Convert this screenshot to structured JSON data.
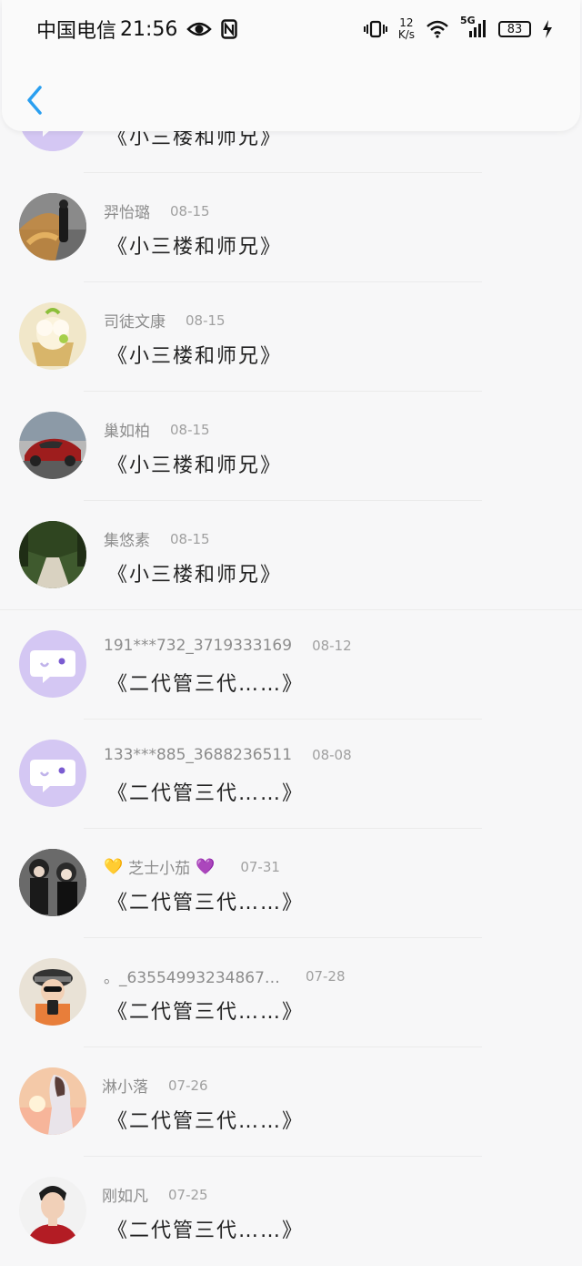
{
  "status_bar": {
    "carrier": "中国电信",
    "time": "21:56",
    "speed_value": "12",
    "speed_unit": "K/s",
    "network": "5G",
    "battery": "83"
  },
  "header": {
    "back_icon": "chevron-left-icon",
    "accent": "#2a9ff0"
  },
  "comments": [
    {
      "name": "",
      "date": "",
      "message": "《小三楼和师兄》",
      "avatar": "default-chat"
    },
    {
      "name": "羿怡璐",
      "date": "08-15",
      "message": "《小三楼和师兄》",
      "avatar": "kick-photo"
    },
    {
      "name": "司徒文康",
      "date": "08-15",
      "message": "《小三楼和师兄》",
      "avatar": "cupcake"
    },
    {
      "name": "巢如柏",
      "date": "08-15",
      "message": "《小三楼和师兄》",
      "avatar": "red-car"
    },
    {
      "name": "集悠素",
      "date": "08-15",
      "message": "《小三楼和师兄》",
      "avatar": "forest-road"
    },
    {
      "name": "191***732_3719333169",
      "date": "08-12",
      "message": "《二代管三代……》",
      "avatar": "default-chat"
    },
    {
      "name": "133***885_3688236511",
      "date": "08-08",
      "message": "《二代管三代……》",
      "avatar": "default-chat"
    },
    {
      "name": "芝士小茄",
      "name_prefix_emoji": "💛",
      "name_suffix_emoji": "💜",
      "date": "07-31",
      "message": "《二代管三代……》",
      "avatar": "couple-photo"
    },
    {
      "name": "。_63554993234867…",
      "date": "07-28",
      "message": "《二代管三代……》",
      "avatar": "hat-selfie"
    },
    {
      "name": "淋小落",
      "date": "07-26",
      "message": "《二代管三代……》",
      "avatar": "sunset-girl"
    },
    {
      "name": "刚如凡",
      "date": "07-25",
      "message": "《二代管三代……》",
      "avatar": "man-portrait"
    }
  ]
}
